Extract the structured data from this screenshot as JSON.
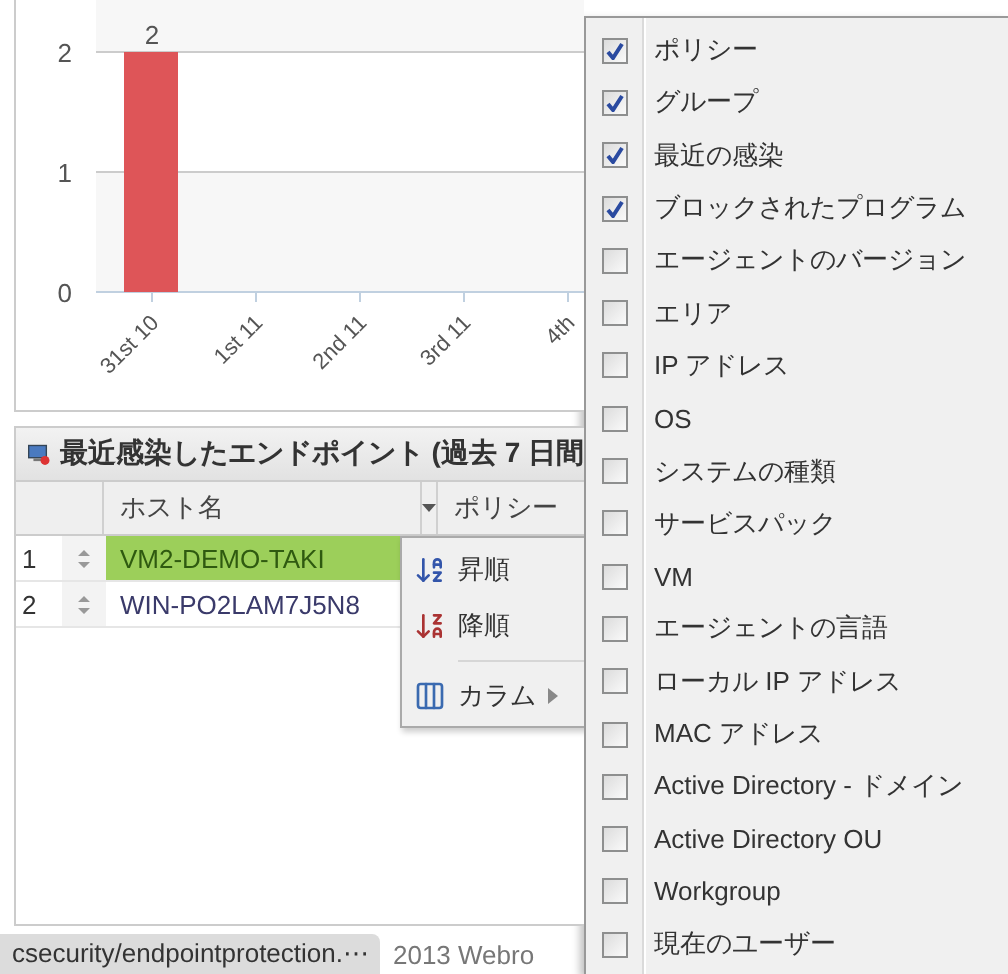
{
  "chart": {
    "chart_data": {
      "type": "bar",
      "categories": [
        "31st 10",
        "1st 11",
        "2nd 11",
        "3rd 11",
        "4th"
      ],
      "series": [
        {
          "color": "#de5558",
          "values": [
            2,
            0,
            0,
            0,
            0
          ]
        }
      ],
      "bands": [
        {
          "axis": "y",
          "from": 0,
          "to": 1,
          "color": "#f7f7f7"
        }
      ],
      "ylim": [
        0,
        2
      ],
      "yticks": [
        0,
        1,
        2
      ],
      "value_labels": [
        "2",
        null,
        null,
        null,
        null
      ]
    }
  },
  "grid": {
    "title": "最近感染したエンドポイント (過去 7 日間",
    "columns": [
      {
        "label": "ホスト名"
      },
      {
        "label": "ポリシー"
      }
    ],
    "rows": [
      {
        "number": "1",
        "host": "VM2-DEMO-TAKI",
        "selected": true
      },
      {
        "number": "2",
        "host": "WIN-PO2LAM7J5N8",
        "selected": false
      }
    ]
  },
  "column_menu": {
    "items": [
      {
        "kind": "sort-asc",
        "label": "昇順"
      },
      {
        "kind": "sort-desc",
        "label": "降順"
      },
      {
        "kind": "columns",
        "label": "カラム"
      }
    ]
  },
  "columns_menu": {
    "items": [
      {
        "label": "ポリシー",
        "checked": true
      },
      {
        "label": "グループ",
        "checked": true
      },
      {
        "label": "最近の感染",
        "checked": true
      },
      {
        "label": "ブロックされたプログラム",
        "checked": true
      },
      {
        "label": "エージェントのバージョン",
        "checked": false
      },
      {
        "label": "エリア",
        "checked": false
      },
      {
        "label": "IP アドレス",
        "checked": false
      },
      {
        "label": "OS",
        "checked": false
      },
      {
        "label": "システムの種類",
        "checked": false
      },
      {
        "label": "サービスパック",
        "checked": false
      },
      {
        "label": "VM",
        "checked": false
      },
      {
        "label": "エージェントの言語",
        "checked": false
      },
      {
        "label": "ローカル IP アドレス",
        "checked": false
      },
      {
        "label": "MAC アドレス",
        "checked": false
      },
      {
        "label": "Active Directory - ドメイン",
        "checked": false
      },
      {
        "label": "Active Directory OU",
        "checked": false
      },
      {
        "label": "Workgroup",
        "checked": false
      },
      {
        "label": "現在のユーザー",
        "checked": false
      }
    ]
  },
  "status_bar": {
    "url": "csecurity/endpointprotection.⋯",
    "copyright": "2013 Webro"
  }
}
